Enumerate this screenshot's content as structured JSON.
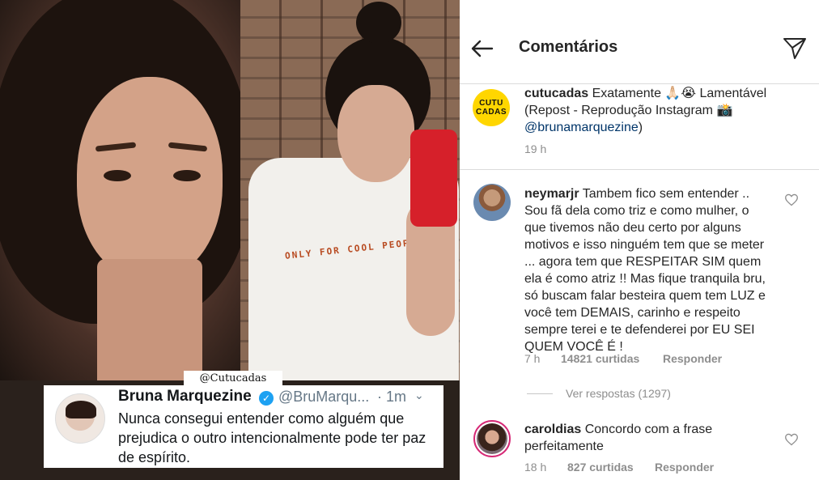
{
  "collage": {
    "watermark": "@Cutucadas",
    "shirt_print": "ONLY FOR COOL PEOPLE"
  },
  "tweet": {
    "name": "Bruna Marquezine",
    "handle": "@BruMarqu...",
    "time": "· 1m",
    "text": "Nunca consegui entender como alguém que prejudica o outro intencionalmente pode ter paz de espírito."
  },
  "header": {
    "title": "Comentários",
    "back_icon": "arrow-left-icon",
    "send_icon": "paper-plane-icon"
  },
  "caption": {
    "avatar_line1": "CUTU",
    "avatar_line2": "CADAS",
    "username": "cutucadas",
    "text": "Exatamente 🙏🏻😭 Lamentável (Repost - Reprodução Instagram 📸",
    "mention": "@brunamarquezine",
    "text_end": ")",
    "time": "19 h"
  },
  "comments": [
    {
      "username": "neymarjr",
      "text": "Tambem fico sem entender .. Sou fã dela como triz e como mulher, o que tivemos não deu certo por alguns motivos e isso ninguém tem que se meter ... agora tem que RESPEITAR SIM quem ela é como atriz !! Mas fique tranquila bru, só buscam falar besteira quem tem LUZ e você tem DEMAIS, carinho e respeito sempre terei e te defenderei por EU SEI QUEM VOCÊ É !",
      "time": "7 h",
      "likes": "14821 curtidas",
      "reply": "Responder",
      "view_replies": "Ver respostas (1297)"
    },
    {
      "username": "caroldias",
      "text": "Concordo com a frase perfeitamente",
      "time": "18 h",
      "likes": "827 curtidas",
      "reply": "Responder"
    }
  ]
}
